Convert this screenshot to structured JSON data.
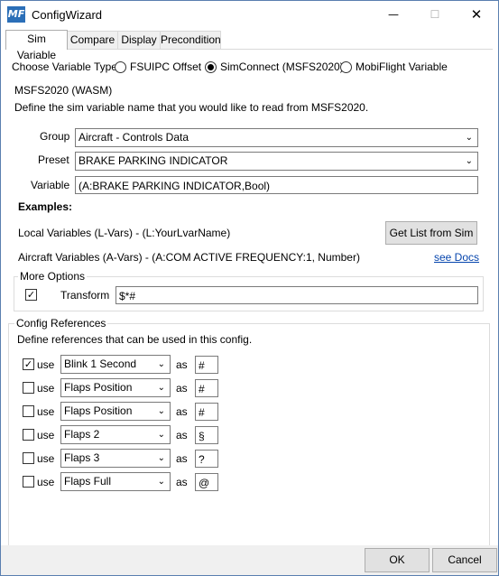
{
  "window": {
    "title": "ConfigWizard",
    "app_icon_text": "MF",
    "minimize": "—",
    "maximize": "☐",
    "close": "✕"
  },
  "tabs": [
    {
      "label": "Sim Variable"
    },
    {
      "label": "Compare"
    },
    {
      "label": "Display"
    },
    {
      "label": "Precondition"
    }
  ],
  "variable_type": {
    "label": "Choose Variable Type",
    "options": [
      {
        "label": "FSUIPC Offset",
        "checked": false
      },
      {
        "label": "SimConnect (MSFS2020)",
        "checked": true
      },
      {
        "label": "MobiFlight Variable",
        "checked": false
      }
    ]
  },
  "msfs": {
    "group_title": "MSFS2020 (WASM)",
    "description": "Define the sim variable name that you would like to read from MSFS2020.",
    "group_label": "Group",
    "group_value": "Aircraft - Controls Data",
    "preset_label": "Preset",
    "preset_value": "BRAKE PARKING INDICATOR",
    "variable_label": "Variable",
    "variable_value": "(A:BRAKE PARKING INDICATOR,Bool)",
    "examples_label": "Examples:",
    "local_vars": "Local Variables (L-Vars) - (L:YourLvarName)",
    "get_list_button": "Get List from Sim",
    "aircraft_vars": "Aircraft Variables (A-Vars) - (A:COM ACTIVE FREQUENCY:1, Number)",
    "see_docs": "see Docs"
  },
  "more_options": {
    "title": "More Options",
    "transform_checked": true,
    "transform_label": "Transform",
    "transform_value": "$*#"
  },
  "config_refs": {
    "title": "Config References",
    "description": "Define references that can be used in this config.",
    "use_label": "use",
    "as_label": "as",
    "rows": [
      {
        "checked": true,
        "ref": "Blink 1 Second",
        "symbol": "#"
      },
      {
        "checked": false,
        "ref": "Flaps Position",
        "symbol": "#"
      },
      {
        "checked": false,
        "ref": "Flaps Position",
        "symbol": "#"
      },
      {
        "checked": false,
        "ref": "Flaps 2",
        "symbol": "§"
      },
      {
        "checked": false,
        "ref": "Flaps 3",
        "symbol": "?"
      },
      {
        "checked": false,
        "ref": "Flaps Full",
        "symbol": "@"
      }
    ]
  },
  "footer": {
    "ok": "OK",
    "cancel": "Cancel"
  },
  "icons": {
    "check": "✓",
    "chevron": "⌄"
  },
  "colors": {
    "link": "#0645ad",
    "title_icon": "#2b6fb8"
  }
}
